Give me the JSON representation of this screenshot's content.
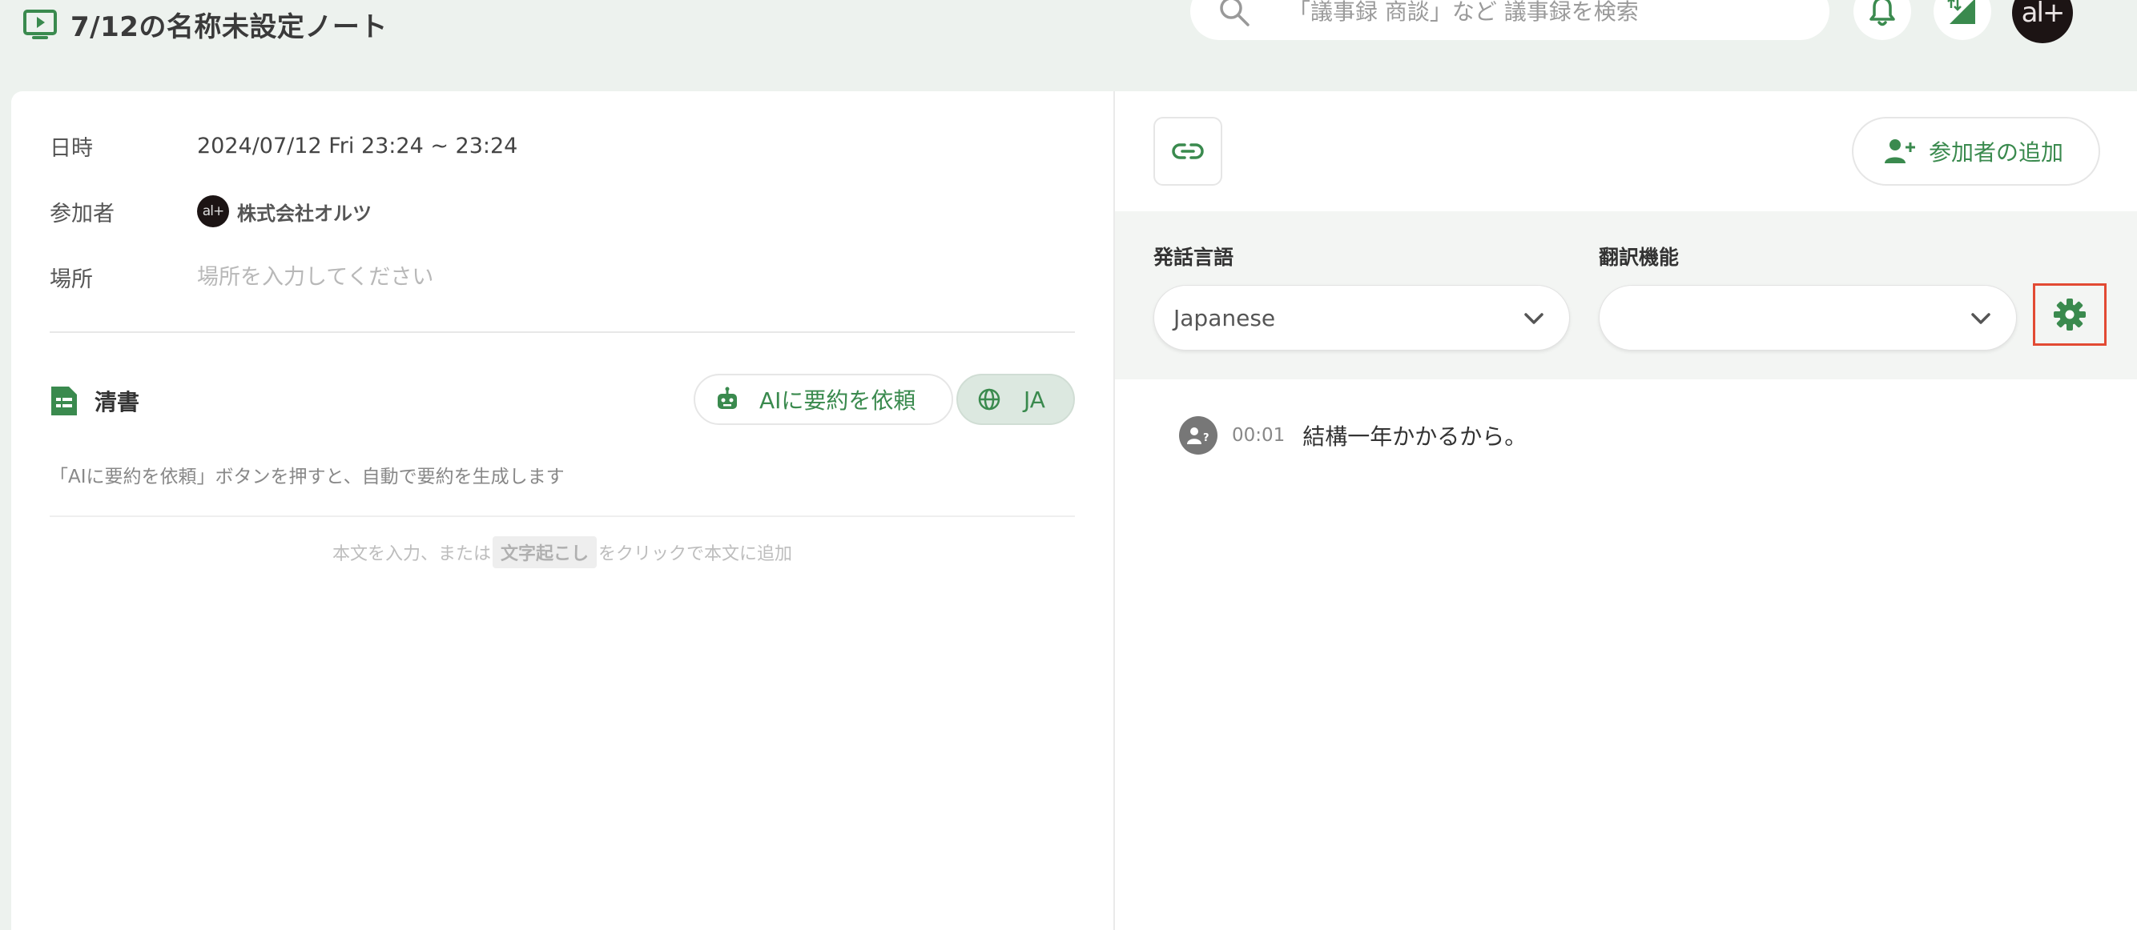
{
  "header": {
    "title": "7/12の名称未設定ノート",
    "title_icon": "play-screen-icon",
    "search": {
      "placeholder": "「議事録 商談」など 議事録を検索",
      "icon": "search-icon"
    },
    "notifications_icon": "bell-icon",
    "signal_icon": "signal-icon",
    "user_avatar_text": "al+"
  },
  "meta": {
    "date_label": "日時",
    "date_value": "2024/07/12 Fri 23:24 ~ 23:24",
    "participants_label": "参加者",
    "participant": {
      "avatar_text": "al+",
      "name": "株式会社オルツ"
    },
    "place_label": "場所",
    "place_placeholder": "場所を入力してください"
  },
  "summary": {
    "section_title": "清書",
    "ai_button_label": "AIに要約を依頼",
    "lang_button_label": "JA",
    "hint": "「AIに要約を依頼」ボタンを押すと、自動で要約を生成します",
    "body_hint_before": "本文を入力、または",
    "body_hint_tag": "文字起こし",
    "body_hint_after": "をクリックで本文に追加"
  },
  "right": {
    "add_participant_label": "参加者の追加",
    "speech_language_label": "発話言語",
    "speech_language_value": "Japanese",
    "translation_label": "翻訳機能",
    "translation_value": "",
    "transcript": [
      {
        "time": "00:01",
        "text": "結構一年かかるから。"
      }
    ]
  },
  "colors": {
    "accent_green": "#3a8a4e",
    "background": "#edf2ee",
    "highlight_red": "#e24a33"
  }
}
